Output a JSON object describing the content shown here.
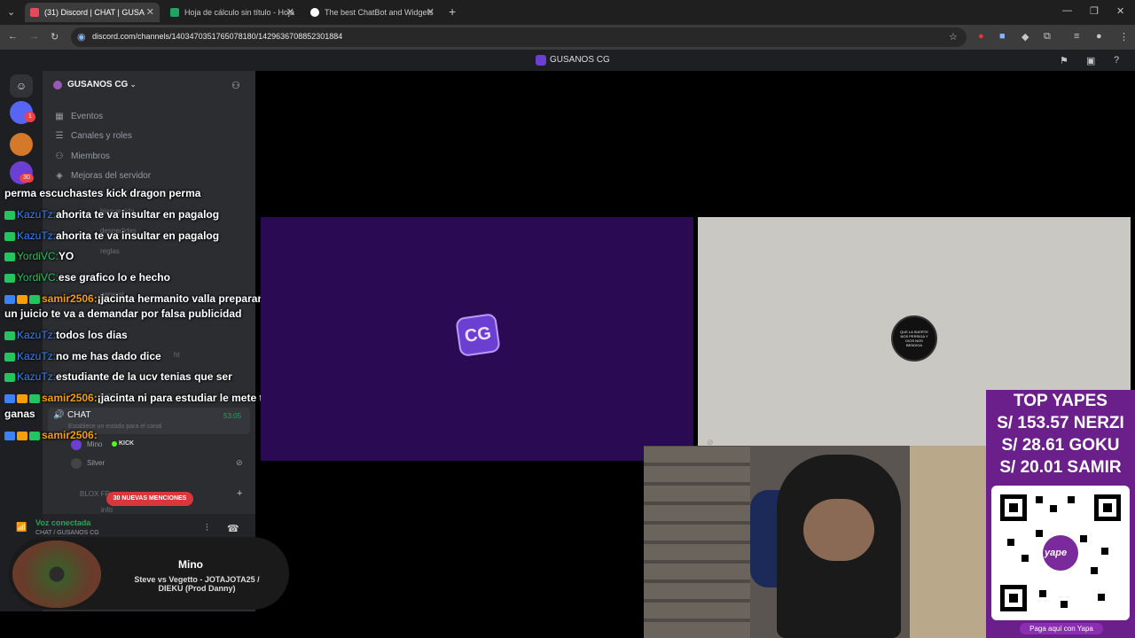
{
  "browser": {
    "tabs": [
      {
        "title": "(31) Discord | CHAT | GUSA",
        "active": true
      },
      {
        "title": "Hoja de cálculo sin título - Hoja",
        "active": false
      },
      {
        "title": "The best ChatBot and Widgets",
        "active": false
      }
    ],
    "url": "discord.com/channels/1403470351765078180/1429636708852301884"
  },
  "discord": {
    "window_title": "GUSANOS CG",
    "server_name": "GUSANOS CG",
    "server_badges": [
      "1",
      "30"
    ],
    "menu_items": [
      "Eventos",
      "Canales y roles",
      "Miembros",
      "Mejoras del servidor"
    ],
    "faint_channels": [
      "bienvenida",
      "despedidas",
      "reglas",
      "general",
      "ht",
      "hosp"
    ],
    "voice_channel": {
      "name": "CHAT",
      "timer": "53:05",
      "status_placeholder": "Establece un estado para el canal",
      "members": [
        "Mino",
        "Silver"
      ],
      "kick_label": "KICK"
    },
    "blox_fruits": "BLOX FR",
    "info": "info",
    "mentions": "30 NUEVAS MENCIONES",
    "voice_status": {
      "title": "Voz conectada",
      "subtitle": "CHAT / GUSANOS CG"
    }
  },
  "chat": [
    {
      "user": "",
      "text": "perma escuchastes kick dragon perma"
    },
    {
      "user": "KazuTz:",
      "text": "ahorita te va insultar en pagalog"
    },
    {
      "user": "KazuTz:",
      "text": "ahorita te va insultar en pagalog"
    },
    {
      "user": "YordiVC:",
      "text": "YO"
    },
    {
      "user": "YordiVC:",
      "text": "ese grafico lo e hecho"
    },
    {
      "user": "samir2506:",
      "text": "¡jacinta hermanito valla preparandote para"
    },
    {
      "user": "",
      "text": "un juicio te va a demandar por falsa publicidad"
    },
    {
      "user": "KazuTz:",
      "text": "todos los dias"
    },
    {
      "user": "KazuTz:",
      "text": "no me has dado dice"
    },
    {
      "user": "KazuTz:",
      "text": "estudiante de la ucv tenias que ser"
    },
    {
      "user": "samir2506:",
      "text": "¡jacinta ni para estudiar le mete tantas"
    },
    {
      "user": "",
      "text": "ganas"
    },
    {
      "user": "samir2506:",
      "text": ""
    }
  ],
  "tiles": {
    "logo_text": "CG",
    "seal_text": "QUE LA SUERTE NOS PERSIGA Y DIOS NOS BENDIGA"
  },
  "donations": {
    "title": "TOP YAPES",
    "entries": [
      "S/ 153.57 NERZI",
      "S/ 28.61 GOKU",
      "S/ 20.01 SAMIR"
    ],
    "qr_brand": "yape",
    "cta": "Paga aquí con Yapa"
  },
  "now_playing": {
    "artist": "Mino",
    "track": "Steve vs Vegetto - JOTAJOTA25 / DIEKU (Prod Danny)"
  },
  "colors": {
    "discord_bg": "#2b2d31",
    "accent_purple": "#6b1f8a",
    "mention_red": "#da373c"
  }
}
